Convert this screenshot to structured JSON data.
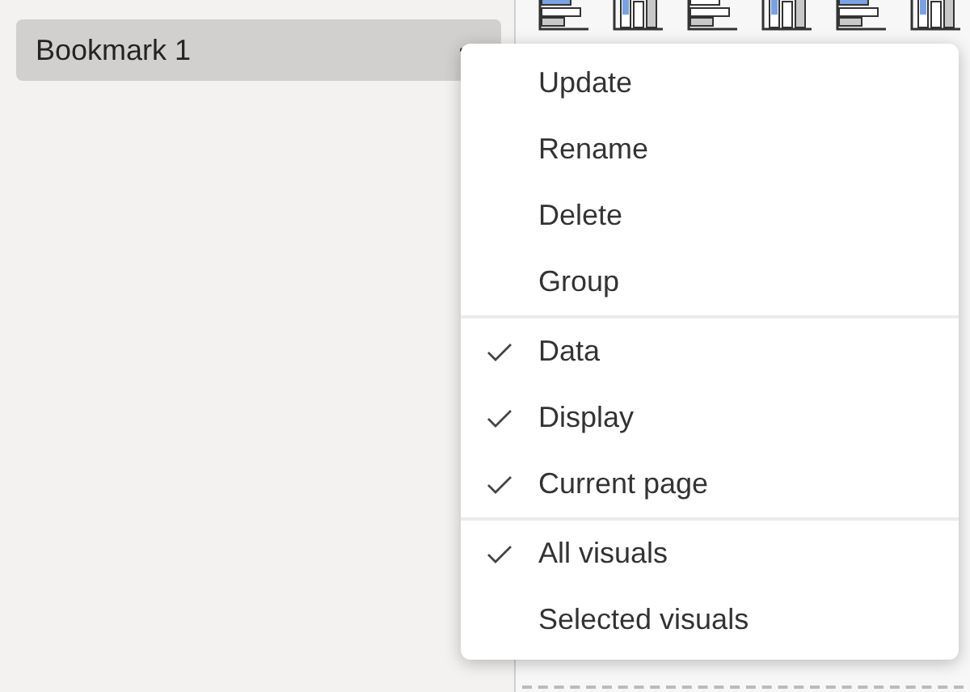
{
  "bookmarks": [
    {
      "label": "Bookmark 1",
      "selected": true
    }
  ],
  "menu": {
    "sections": [
      [
        {
          "label": "Update",
          "kind": "action"
        },
        {
          "label": "Rename",
          "kind": "action"
        },
        {
          "label": "Delete",
          "kind": "action"
        },
        {
          "label": "Group",
          "kind": "action"
        }
      ],
      [
        {
          "label": "Data",
          "kind": "toggle",
          "checked": true
        },
        {
          "label": "Display",
          "kind": "toggle",
          "checked": true
        },
        {
          "label": "Current page",
          "kind": "toggle",
          "checked": true
        }
      ],
      [
        {
          "label": "All visuals",
          "kind": "toggle",
          "checked": true
        },
        {
          "label": "Selected visuals",
          "kind": "toggle",
          "checked": false
        }
      ]
    ]
  }
}
